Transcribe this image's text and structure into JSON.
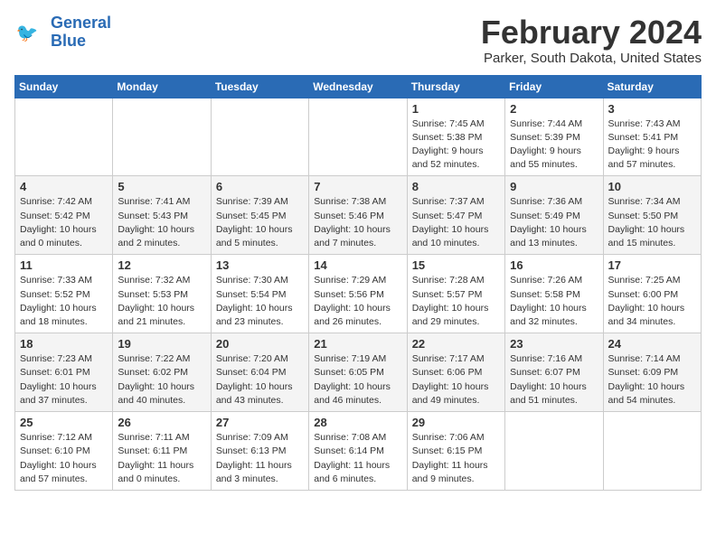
{
  "header": {
    "logo_line1": "General",
    "logo_line2": "Blue",
    "title": "February 2024",
    "subtitle": "Parker, South Dakota, United States"
  },
  "days_of_week": [
    "Sunday",
    "Monday",
    "Tuesday",
    "Wednesday",
    "Thursday",
    "Friday",
    "Saturday"
  ],
  "weeks": [
    [
      {
        "day": "",
        "info": ""
      },
      {
        "day": "",
        "info": ""
      },
      {
        "day": "",
        "info": ""
      },
      {
        "day": "",
        "info": ""
      },
      {
        "day": "1",
        "info": "Sunrise: 7:45 AM\nSunset: 5:38 PM\nDaylight: 9 hours\nand 52 minutes."
      },
      {
        "day": "2",
        "info": "Sunrise: 7:44 AM\nSunset: 5:39 PM\nDaylight: 9 hours\nand 55 minutes."
      },
      {
        "day": "3",
        "info": "Sunrise: 7:43 AM\nSunset: 5:41 PM\nDaylight: 9 hours\nand 57 minutes."
      }
    ],
    [
      {
        "day": "4",
        "info": "Sunrise: 7:42 AM\nSunset: 5:42 PM\nDaylight: 10 hours\nand 0 minutes."
      },
      {
        "day": "5",
        "info": "Sunrise: 7:41 AM\nSunset: 5:43 PM\nDaylight: 10 hours\nand 2 minutes."
      },
      {
        "day": "6",
        "info": "Sunrise: 7:39 AM\nSunset: 5:45 PM\nDaylight: 10 hours\nand 5 minutes."
      },
      {
        "day": "7",
        "info": "Sunrise: 7:38 AM\nSunset: 5:46 PM\nDaylight: 10 hours\nand 7 minutes."
      },
      {
        "day": "8",
        "info": "Sunrise: 7:37 AM\nSunset: 5:47 PM\nDaylight: 10 hours\nand 10 minutes."
      },
      {
        "day": "9",
        "info": "Sunrise: 7:36 AM\nSunset: 5:49 PM\nDaylight: 10 hours\nand 13 minutes."
      },
      {
        "day": "10",
        "info": "Sunrise: 7:34 AM\nSunset: 5:50 PM\nDaylight: 10 hours\nand 15 minutes."
      }
    ],
    [
      {
        "day": "11",
        "info": "Sunrise: 7:33 AM\nSunset: 5:52 PM\nDaylight: 10 hours\nand 18 minutes."
      },
      {
        "day": "12",
        "info": "Sunrise: 7:32 AM\nSunset: 5:53 PM\nDaylight: 10 hours\nand 21 minutes."
      },
      {
        "day": "13",
        "info": "Sunrise: 7:30 AM\nSunset: 5:54 PM\nDaylight: 10 hours\nand 23 minutes."
      },
      {
        "day": "14",
        "info": "Sunrise: 7:29 AM\nSunset: 5:56 PM\nDaylight: 10 hours\nand 26 minutes."
      },
      {
        "day": "15",
        "info": "Sunrise: 7:28 AM\nSunset: 5:57 PM\nDaylight: 10 hours\nand 29 minutes."
      },
      {
        "day": "16",
        "info": "Sunrise: 7:26 AM\nSunset: 5:58 PM\nDaylight: 10 hours\nand 32 minutes."
      },
      {
        "day": "17",
        "info": "Sunrise: 7:25 AM\nSunset: 6:00 PM\nDaylight: 10 hours\nand 34 minutes."
      }
    ],
    [
      {
        "day": "18",
        "info": "Sunrise: 7:23 AM\nSunset: 6:01 PM\nDaylight: 10 hours\nand 37 minutes."
      },
      {
        "day": "19",
        "info": "Sunrise: 7:22 AM\nSunset: 6:02 PM\nDaylight: 10 hours\nand 40 minutes."
      },
      {
        "day": "20",
        "info": "Sunrise: 7:20 AM\nSunset: 6:04 PM\nDaylight: 10 hours\nand 43 minutes."
      },
      {
        "day": "21",
        "info": "Sunrise: 7:19 AM\nSunset: 6:05 PM\nDaylight: 10 hours\nand 46 minutes."
      },
      {
        "day": "22",
        "info": "Sunrise: 7:17 AM\nSunset: 6:06 PM\nDaylight: 10 hours\nand 49 minutes."
      },
      {
        "day": "23",
        "info": "Sunrise: 7:16 AM\nSunset: 6:07 PM\nDaylight: 10 hours\nand 51 minutes."
      },
      {
        "day": "24",
        "info": "Sunrise: 7:14 AM\nSunset: 6:09 PM\nDaylight: 10 hours\nand 54 minutes."
      }
    ],
    [
      {
        "day": "25",
        "info": "Sunrise: 7:12 AM\nSunset: 6:10 PM\nDaylight: 10 hours\nand 57 minutes."
      },
      {
        "day": "26",
        "info": "Sunrise: 7:11 AM\nSunset: 6:11 PM\nDaylight: 11 hours\nand 0 minutes."
      },
      {
        "day": "27",
        "info": "Sunrise: 7:09 AM\nSunset: 6:13 PM\nDaylight: 11 hours\nand 3 minutes."
      },
      {
        "day": "28",
        "info": "Sunrise: 7:08 AM\nSunset: 6:14 PM\nDaylight: 11 hours\nand 6 minutes."
      },
      {
        "day": "29",
        "info": "Sunrise: 7:06 AM\nSunset: 6:15 PM\nDaylight: 11 hours\nand 9 minutes."
      },
      {
        "day": "",
        "info": ""
      },
      {
        "day": "",
        "info": ""
      }
    ]
  ]
}
